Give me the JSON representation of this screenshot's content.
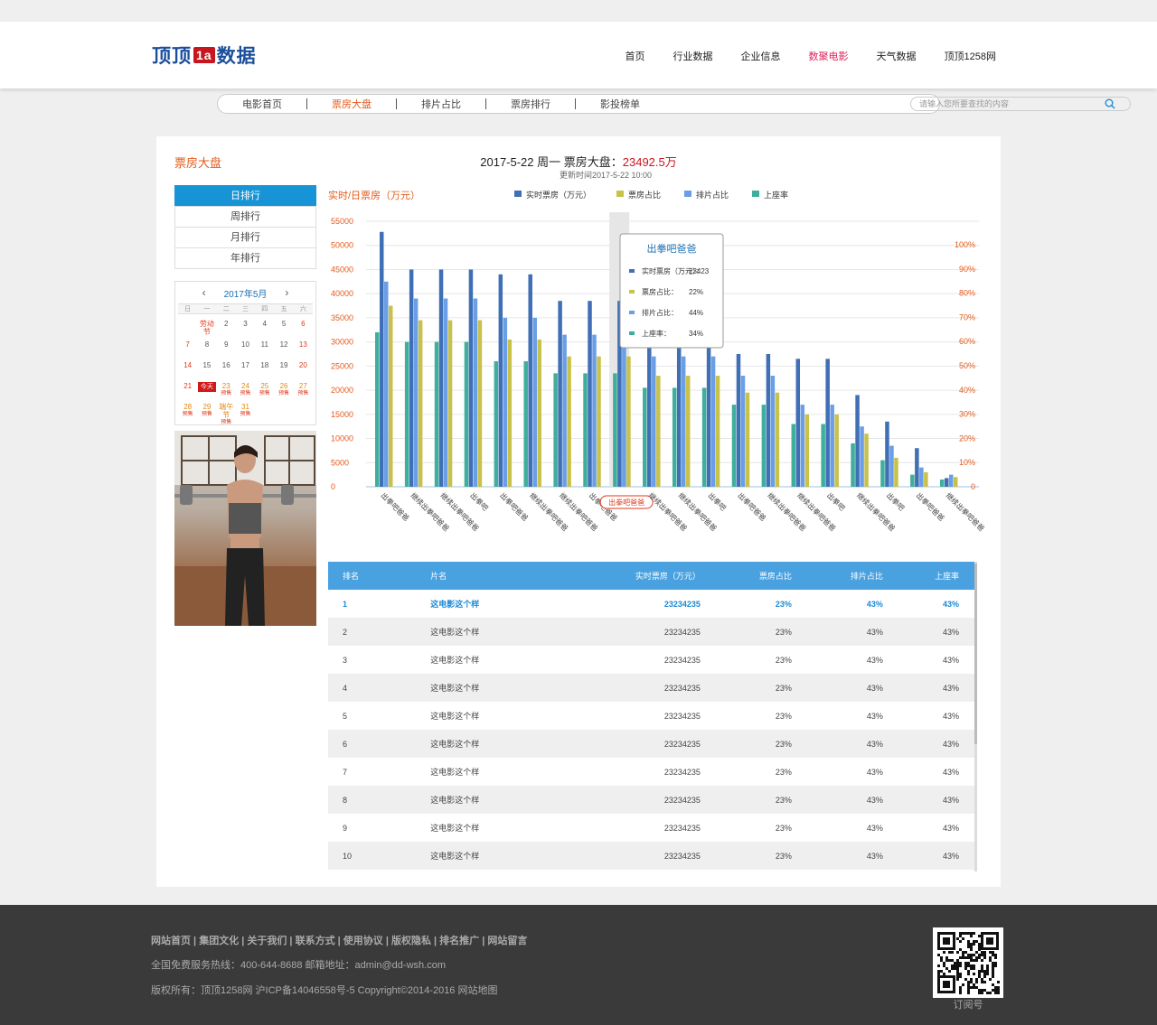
{
  "logo": {
    "left": "顶顶",
    "mark": "1a",
    "right": "数据"
  },
  "nav": [
    {
      "label": "首页",
      "active": false
    },
    {
      "label": "行业数据",
      "active": false
    },
    {
      "label": "企业信息",
      "active": false
    },
    {
      "label": "数聚电影",
      "active": true
    },
    {
      "label": "天气数据",
      "active": false
    },
    {
      "label": "顶顶1258网",
      "active": false
    }
  ],
  "subnav": {
    "items": [
      "电影首页",
      "票房大盘",
      "排片占比",
      "票房排行",
      "影投榜单"
    ],
    "active_index": 1,
    "search_placeholder": "请输入您所要查找的内容"
  },
  "panel": {
    "title": "票房大盘",
    "headline_date": "2017-5-22  周一   票房大盘：",
    "headline_amount": "23492.5万",
    "updated": "更新时间2017-5-22      10:00"
  },
  "rank_tabs": [
    {
      "label": "日排行",
      "active": true
    },
    {
      "label": "周排行",
      "active": false
    },
    {
      "label": "月排行",
      "active": false
    },
    {
      "label": "年排行",
      "active": false
    }
  ],
  "calendar": {
    "month": "2017年5月",
    "weekdays": [
      "日",
      "一",
      "二",
      "三",
      "四",
      "五",
      "六"
    ],
    "cells": [
      {
        "d": "",
        "s": ""
      },
      {
        "d": "劳动节",
        "s": "",
        "c": "red"
      },
      {
        "d": "2",
        "s": ""
      },
      {
        "d": "3",
        "s": ""
      },
      {
        "d": "4",
        "s": ""
      },
      {
        "d": "5",
        "s": ""
      },
      {
        "d": "6",
        "s": "",
        "c": "red"
      },
      {
        "d": "7",
        "s": "",
        "c": "red"
      },
      {
        "d": "8",
        "s": ""
      },
      {
        "d": "9",
        "s": ""
      },
      {
        "d": "10",
        "s": ""
      },
      {
        "d": "11",
        "s": ""
      },
      {
        "d": "12",
        "s": ""
      },
      {
        "d": "13",
        "s": "",
        "c": "red"
      },
      {
        "d": "14",
        "s": "",
        "c": "red"
      },
      {
        "d": "15",
        "s": ""
      },
      {
        "d": "16",
        "s": ""
      },
      {
        "d": "17",
        "s": ""
      },
      {
        "d": "18",
        "s": ""
      },
      {
        "d": "19",
        "s": ""
      },
      {
        "d": "20",
        "s": "",
        "c": "red"
      },
      {
        "d": "21",
        "s": "",
        "c": "red"
      },
      {
        "d": "今天",
        "s": "",
        "c": "today"
      },
      {
        "d": "23",
        "s": "预售",
        "c": "orange"
      },
      {
        "d": "24",
        "s": "预售",
        "c": "orange"
      },
      {
        "d": "25",
        "s": "预售",
        "c": "orange"
      },
      {
        "d": "26",
        "s": "预售",
        "c": "orange"
      },
      {
        "d": "27",
        "s": "预售",
        "c": "orange"
      },
      {
        "d": "28",
        "s": "预售",
        "c": "orange"
      },
      {
        "d": "29",
        "s": "预售",
        "c": "orange"
      },
      {
        "d": "端午节",
        "s": "预售",
        "c": "orange"
      },
      {
        "d": "31",
        "s": "预售",
        "c": "orange"
      },
      {
        "d": "",
        "s": ""
      },
      {
        "d": "",
        "s": ""
      },
      {
        "d": "",
        "s": ""
      }
    ]
  },
  "chart_data": {
    "type": "bar",
    "ylabel": "实时/日票房（万元）",
    "ylim": [
      0,
      55000
    ],
    "y_ticks": [
      "0",
      "5000",
      "10000",
      "15000",
      "20000",
      "25000",
      "30000",
      "35000",
      "40000",
      "45000",
      "50000",
      "55000"
    ],
    "y2lim": [
      0,
      100
    ],
    "y2_ticks": [
      "0",
      "10%",
      "20%",
      "30%",
      "40%",
      "50%",
      "60%",
      "70%",
      "80%",
      "90%",
      "100%"
    ],
    "legend_position": "top",
    "categories": [
      "出拳吧爸爸",
      "继续出拳吧爸爸",
      "继续出拳吧爸爸",
      "出拳吧",
      "出拳吧爸爸",
      "继续出拳吧爸爸",
      "继续出拳吧爸爸",
      "出拳吧爸爸",
      "出拳吧爸爸",
      "继续出拳吧爸爸",
      "继续出拳吧爸爸",
      "出拳吧",
      "出拳吧爸爸",
      "继续出拳吧爸爸",
      "继续出拳吧爸爸",
      "出拳吧",
      "继续出拳吧爸爸",
      "出拳吧",
      "出拳吧爸爸",
      "继续出拳吧爸爸"
    ],
    "highlight_index": 8,
    "series": [
      {
        "name": "实时票房（万元）",
        "color": "#3f6fb5",
        "axis": "left",
        "values": [
          52800,
          45000,
          45000,
          45000,
          44000,
          44000,
          38500,
          38500,
          38500,
          30000,
          30000,
          30000,
          27500,
          27500,
          26500,
          26500,
          19000,
          13500,
          8000,
          1800
        ]
      },
      {
        "name": "票房占比",
        "color": "#c9c24a",
        "axis": "left",
        "values": [
          37500,
          34500,
          34500,
          34500,
          30500,
          30500,
          27000,
          27000,
          27000,
          23000,
          23000,
          23000,
          19500,
          19500,
          15000,
          15000,
          11000,
          6000,
          3000,
          2000
        ]
      },
      {
        "name": "排片占比",
        "color": "#6a9ee6",
        "axis": "left",
        "values": [
          42500,
          39000,
          39000,
          39000,
          35000,
          35000,
          31500,
          31500,
          31500,
          27000,
          27000,
          27000,
          23000,
          23000,
          17000,
          17000,
          12500,
          8500,
          4000,
          2500
        ]
      },
      {
        "name": "上座率",
        "color": "#3fae9c",
        "axis": "left",
        "values": [
          32000,
          30000,
          30000,
          30000,
          26000,
          26000,
          23500,
          23500,
          23500,
          20500,
          20500,
          20500,
          17000,
          17000,
          13000,
          13000,
          9000,
          5500,
          2500,
          1500
        ]
      }
    ],
    "tooltip": {
      "title": "出拳吧爸爸",
      "rows": [
        {
          "label": "实时票房（万元）：",
          "value": "23423",
          "color": "#3f6fb5"
        },
        {
          "label": "票房占比：",
          "value": "22%",
          "color": "#c9c24a"
        },
        {
          "label": "排片占比：",
          "value": "44%",
          "color": "#6a9ee6"
        },
        {
          "label": "上座率：",
          "value": "34%",
          "color": "#3fae9c"
        }
      ]
    }
  },
  "table": {
    "headers": [
      "排名",
      "片名",
      "实时票房（万元）",
      "票房占比",
      "排片占比",
      "上座率"
    ],
    "rows": [
      [
        "1",
        "这电影这个样",
        "23234235",
        "23%",
        "43%",
        "43%"
      ],
      [
        "2",
        "这电影这个样",
        "23234235",
        "23%",
        "43%",
        "43%"
      ],
      [
        "3",
        "这电影这个样",
        "23234235",
        "23%",
        "43%",
        "43%"
      ],
      [
        "4",
        "这电影这个样",
        "23234235",
        "23%",
        "43%",
        "43%"
      ],
      [
        "5",
        "这电影这个样",
        "23234235",
        "23%",
        "43%",
        "43%"
      ],
      [
        "6",
        "这电影这个样",
        "23234235",
        "23%",
        "43%",
        "43%"
      ],
      [
        "7",
        "这电影这个样",
        "23234235",
        "23%",
        "43%",
        "43%"
      ],
      [
        "8",
        "这电影这个样",
        "23234235",
        "23%",
        "43%",
        "43%"
      ],
      [
        "9",
        "这电影这个样",
        "23234235",
        "23%",
        "43%",
        "43%"
      ],
      [
        "10",
        "这电影这个样",
        "23234235",
        "23%",
        "43%",
        "43%"
      ]
    ]
  },
  "footer": {
    "links": "网站首页 | 集团文化 | 关于我们 | 联系方式 | 使用协议 | 版权隐私 | 排名推广 | 网站留言",
    "hotline": "全国免费服务热线：400-644-8688 邮箱地址：admin@dd-wsh.com",
    "copyright": "版权所有：顶顶1258网 沪ICP备14046558号-5 Copyright©2014-2016 网站地图",
    "qr_label": "订阅号"
  }
}
